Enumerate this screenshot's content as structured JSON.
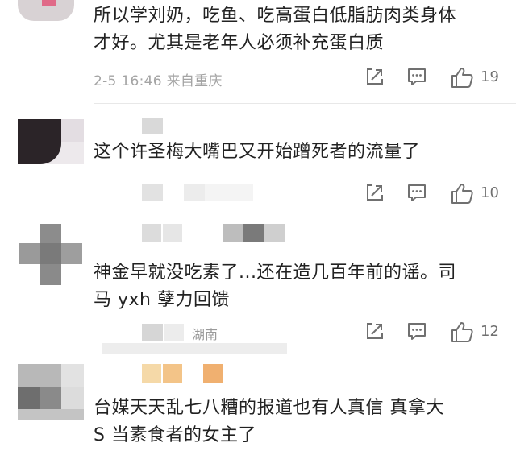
{
  "comments": [
    {
      "text": "所以学刘奶，吃鱼、吃高蛋白低脂肪肉类身体\n才好。尤其是老年人必须补充蛋白质",
      "meta": "2-5 16:46  来自重庆",
      "like_count": "19"
    },
    {
      "text": "这个许圣梅大嘴巴又开始蹭死者的流量了",
      "like_count": "10"
    },
    {
      "text": "神金早就没吃素了...还在造几百年前的谣。司\n马 yxh 孽力回馈",
      "meta_fragment": "湖南",
      "like_count": "12"
    },
    {
      "text": "台媒天天乱七八糟的报道也有人真信 真拿大\nS 当素食者的女主了"
    }
  ],
  "icons": {
    "share": "share-icon",
    "reply": "comment-icon",
    "like": "thumbs-up-icon"
  },
  "colors": {
    "meta_text": "#a4a4a4",
    "action_icon": "#707070",
    "body_text": "#222222"
  }
}
